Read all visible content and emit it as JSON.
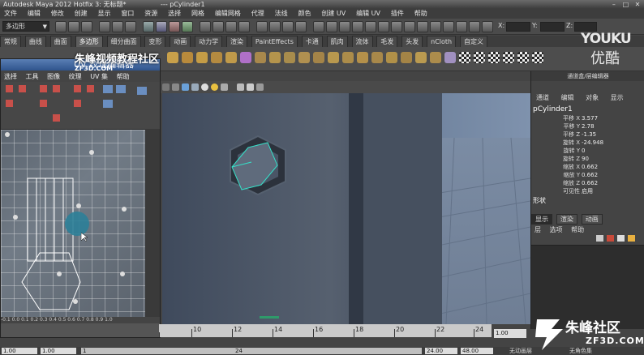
{
  "window": {
    "title": "Autodesk Maya 2012 Hotfix 3: 无标题*",
    "object_suffix": "---   pCylinder1",
    "controls": [
      "–",
      "□",
      "✕"
    ]
  },
  "menubar": [
    "文件",
    "编辑",
    "修改",
    "创建",
    "显示",
    "窗口",
    "资源",
    "选择",
    "网格",
    "编辑网格",
    "代理",
    "法线",
    "颜色",
    "创建 UV",
    "编辑 UV",
    "插件",
    "帮助"
  ],
  "status": {
    "mode": "多边形",
    "x_label": "X:",
    "y_label": "Y:",
    "z_label": "Z:"
  },
  "shelf_tabs": [
    "常规",
    "曲线",
    "曲面",
    "多边形",
    "细分曲面",
    "变形",
    "动画",
    "动力学",
    "渲染",
    "PaintEffects",
    "卡通",
    "肌肉",
    "流体",
    "毛发",
    "头发",
    "nCloth",
    "自定义"
  ],
  "shelf_active_index": 3,
  "uv_window": {
    "title": "UV 纹理编辑器",
    "watermark": "朱峰视频教程社区",
    "watermark_site": "ZF3D.COM",
    "menu": [
      "选择",
      "工具",
      "图像",
      "纹理",
      "UV 集",
      "帮助"
    ],
    "coords": "-0.1  0.0  0.1  0.2  0.3  0.4  0.5  0.6  0.7  0.8  0.9  1.0"
  },
  "channel_box": {
    "header": "通道盒/层编辑器",
    "menu": [
      "通道",
      "编辑",
      "对象",
      "显示"
    ],
    "object": "pCylinder1",
    "attributes": [
      {
        "name": "平移 X",
        "value": "3.577"
      },
      {
        "name": "平移 Y",
        "value": "2.78"
      },
      {
        "name": "平移 Z",
        "value": "-1.35"
      },
      {
        "name": "旋转 X",
        "value": "-24.948"
      },
      {
        "name": "旋转 Y",
        "value": "0"
      },
      {
        "name": "旋转 Z",
        "value": "90"
      },
      {
        "name": "缩放 X",
        "value": "0.662"
      },
      {
        "name": "缩放 Y",
        "value": "0.662"
      },
      {
        "name": "缩放 Z",
        "value": "0.662"
      },
      {
        "name": "可见性",
        "value": "启用"
      }
    ],
    "shapes_label": "形状",
    "layer_tabs": [
      "显示",
      "渲染",
      "动画"
    ],
    "layer_menu": [
      "层",
      "选项",
      "帮助"
    ]
  },
  "timeline": {
    "ticks": [
      "10",
      "12",
      "14",
      "16",
      "18",
      "20",
      "22",
      "24"
    ],
    "current_frame": "1.00"
  },
  "range": {
    "start": "1.00",
    "start2": "1.00",
    "frame": "1",
    "slider_end": "24",
    "end": "24.00",
    "end2": "48.00",
    "anim_layer": "无动画层",
    "char_set": "无角色集"
  },
  "watermark_tr": {
    "brand": "YOUKU",
    "brand_cn": "优酷"
  },
  "watermark_br": {
    "name": "朱峰社区",
    "url": "ZF3D.COM"
  }
}
